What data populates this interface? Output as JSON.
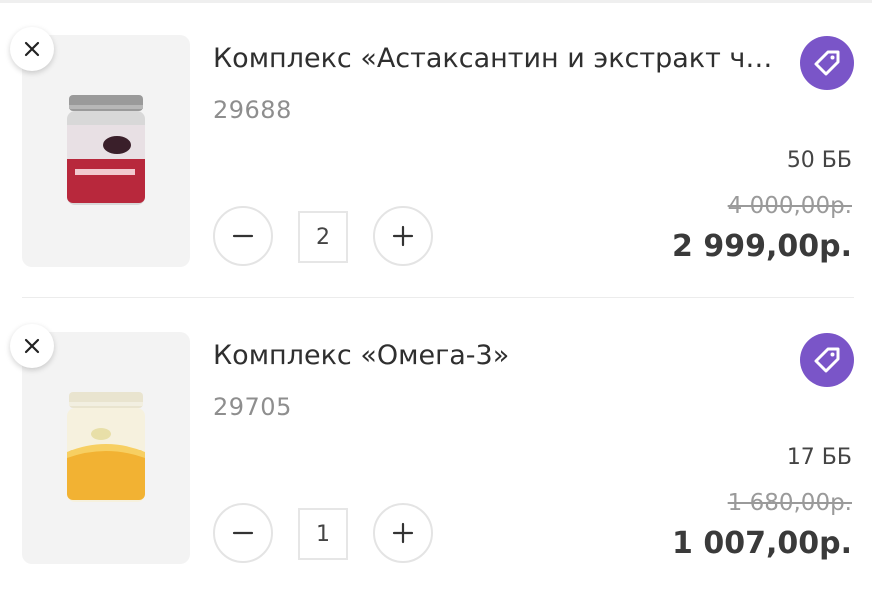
{
  "colors": {
    "accent": "#7a55c8",
    "text": "#2f2f2f",
    "muted": "#8e8e8e"
  },
  "items": [
    {
      "name": "Комплекс «Астаксантин и экстракт чер...",
      "sku": "29688",
      "quantity": "2",
      "points": "50 ББ",
      "old_price": "4 000,00р.",
      "price": "2 999,00р.",
      "image_icon": "supplement-jar-red",
      "tag_icon": "price-tag-icon",
      "remove_icon": "close-icon"
    },
    {
      "name": "Комплекс «Омега-3»",
      "sku": "29705",
      "quantity": "1",
      "points": "17 ББ",
      "old_price": "1 680,00р.",
      "price": "1 007,00р.",
      "image_icon": "supplement-jar-yellow",
      "tag_icon": "price-tag-icon",
      "remove_icon": "close-icon"
    }
  ]
}
